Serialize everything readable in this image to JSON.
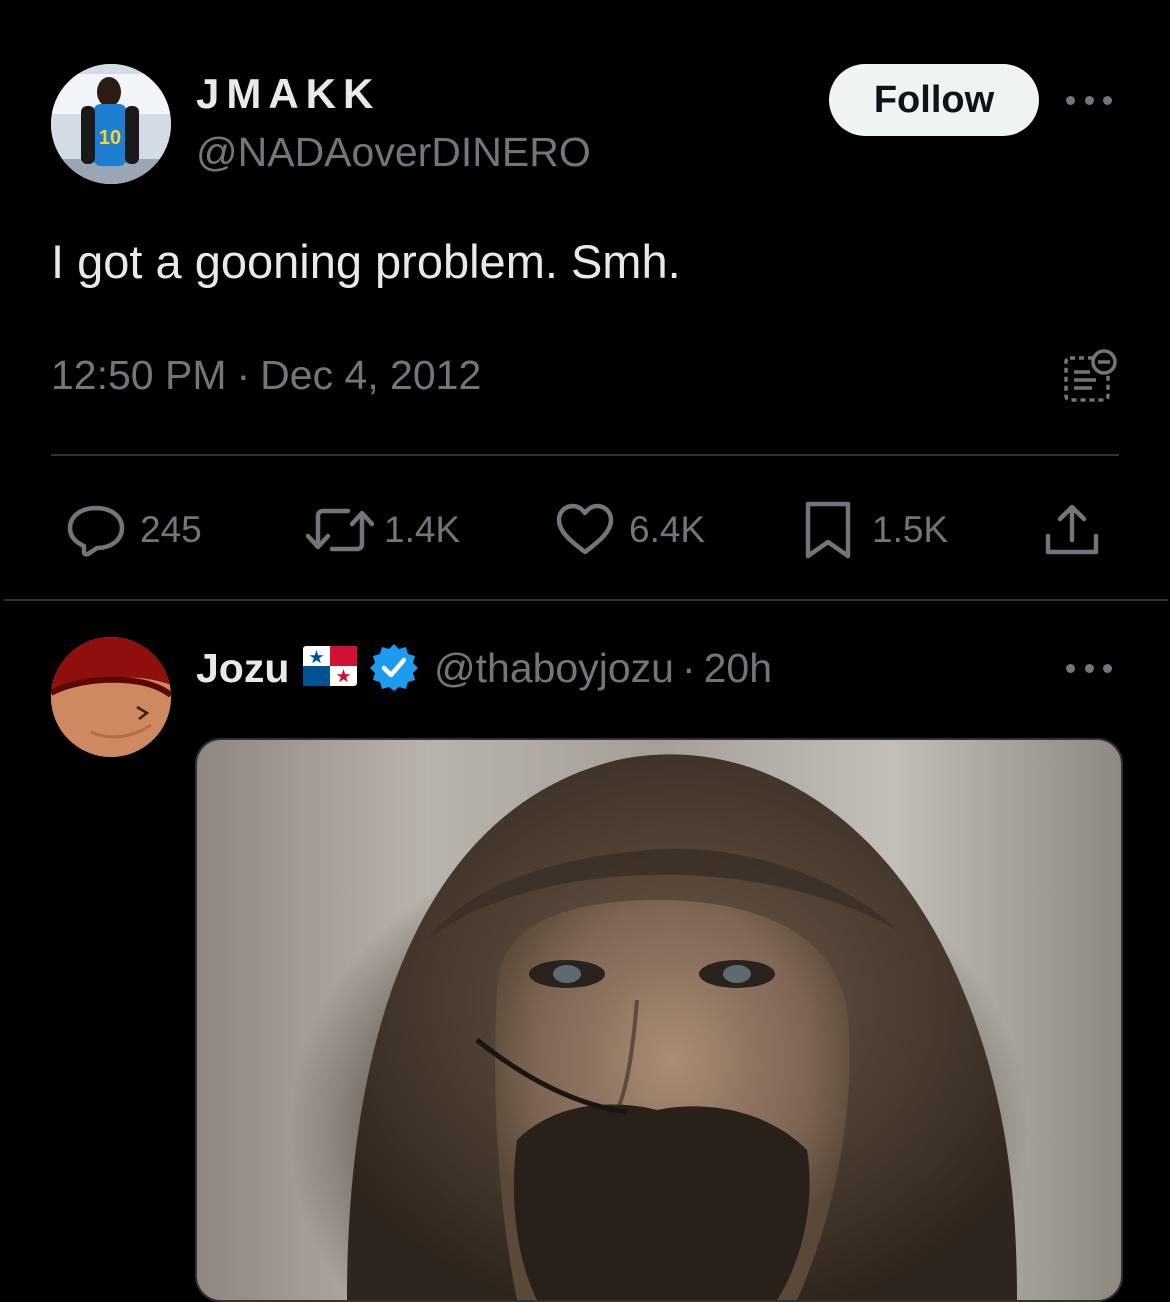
{
  "main_tweet": {
    "display_name": "JMAKK",
    "handle": "@NADAoverDINERO",
    "follow_label": "Follow",
    "text": "I got a gooning problem. Smh.",
    "time": "12:50 PM",
    "separator": "·",
    "date": "Dec 4, 2012",
    "actions": {
      "replies": "245",
      "reposts": "1.4K",
      "likes": "6.4K",
      "bookmarks": "1.5K"
    }
  },
  "reply_tweet": {
    "display_name": "Jozu",
    "flag_icon": "panama-flag-icon",
    "verified_icon": "verified-badge-icon",
    "handle": "@thaboyjozu",
    "separator": "·",
    "time": "20h"
  },
  "colors": {
    "background": "#000000",
    "primary_text": "#e7e9ea",
    "secondary_text": "#71767b",
    "divider": "#2f3336",
    "follow_button": "#eff3f4",
    "verified_blue": "#1d9bf0"
  }
}
